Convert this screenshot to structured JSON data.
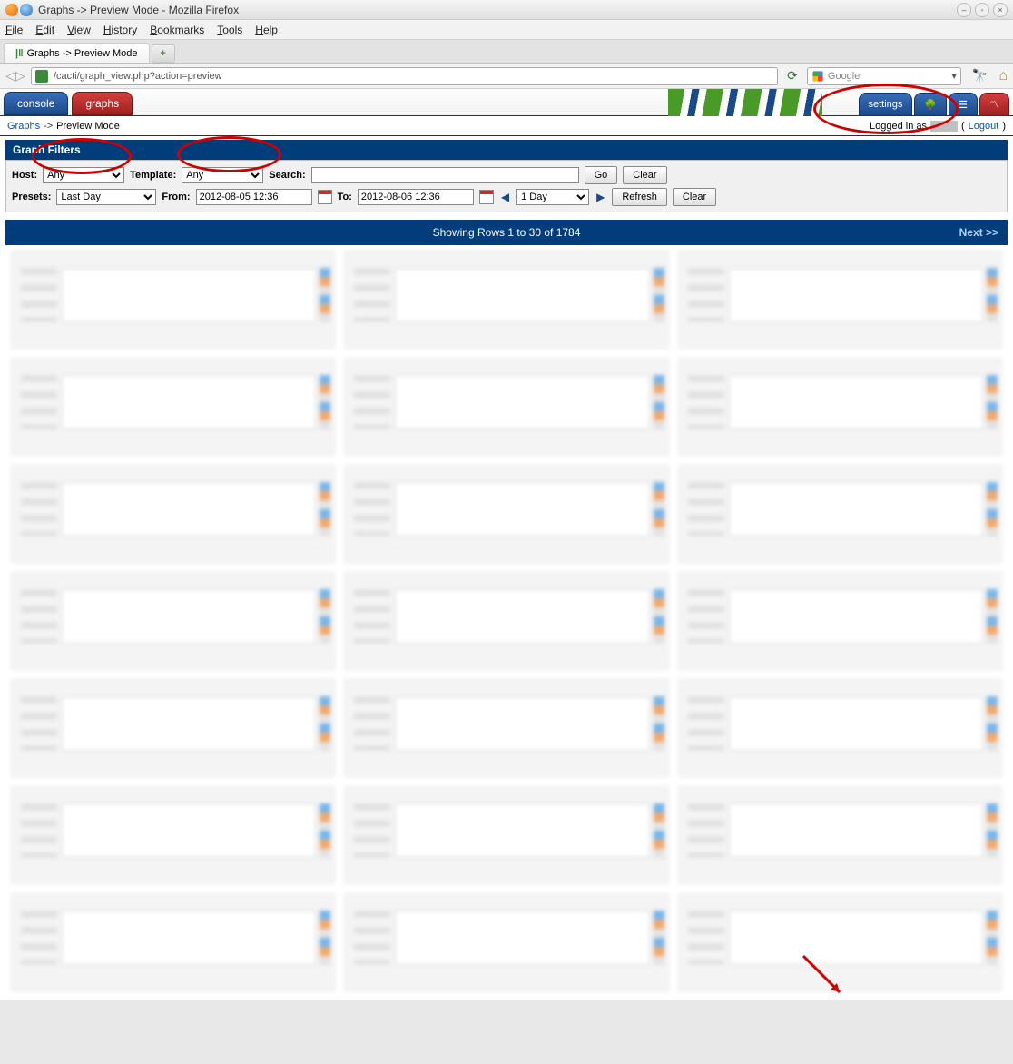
{
  "window": {
    "title": "Graphs -> Preview Mode - Mozilla Firefox"
  },
  "menubar": {
    "file": "File",
    "edit": "Edit",
    "view": "View",
    "history": "History",
    "bookmarks": "Bookmarks",
    "tools": "Tools",
    "help": "Help"
  },
  "tab": {
    "label": "Graphs -> Preview Mode"
  },
  "urlbar": {
    "path": "/cacti/graph_view.php?action=preview",
    "search_placeholder": "Google"
  },
  "cacti": {
    "tabs": {
      "console": "console",
      "graphs": "graphs",
      "settings": "settings"
    },
    "breadcrumb": {
      "graphs": "Graphs",
      "sep": "->",
      "preview": "Preview Mode"
    },
    "login": {
      "prefix": "Logged in as",
      "logout": "Logout"
    }
  },
  "filters": {
    "title": "Graph Filters",
    "host_label": "Host:",
    "host_value": "Any",
    "template_label": "Template:",
    "template_value": "Any",
    "search_label": "Search:",
    "go": "Go",
    "clear": "Clear",
    "presets_label": "Presets:",
    "presets_value": "Last Day",
    "from_label": "From:",
    "from_value": "2012-08-05 12:36",
    "to_label": "To:",
    "to_value": "2012-08-06 12:36",
    "span": "1 Day",
    "refresh": "Refresh"
  },
  "results": {
    "text": "Showing Rows 1 to 30 of 1784",
    "next": "Next >>"
  }
}
